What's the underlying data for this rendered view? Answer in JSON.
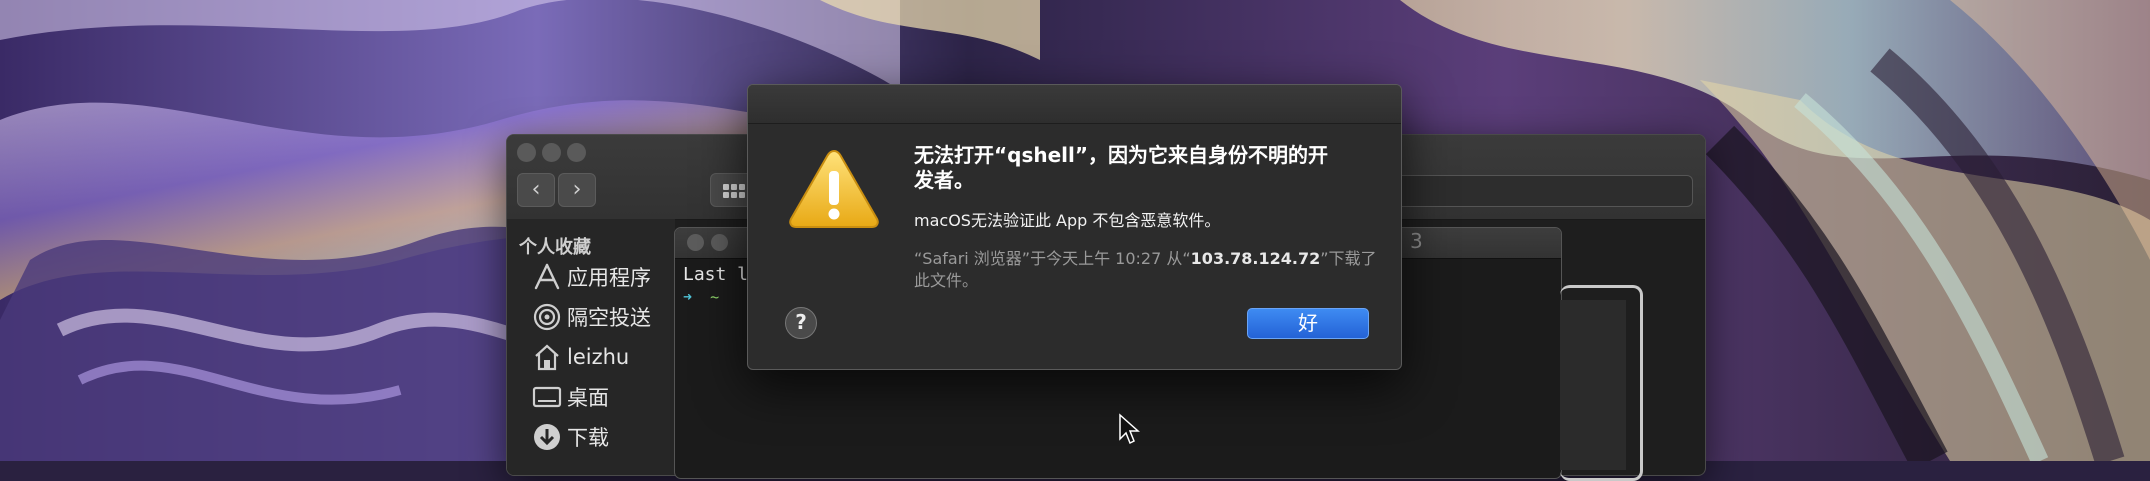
{
  "alert": {
    "title": "无法打开“qshell”，因为它来自身份不明的开发者。",
    "message": "macOS无法验证此 App 不包含恶意软件。",
    "info_prefix": "“Safari 浏览器”于今天上午 10:27 从“",
    "info_host": "103.78.124.72",
    "info_suffix": "”下载了此文件。",
    "help_label": "?",
    "ok_label": "好",
    "icon": "warning-icon"
  },
  "finder": {
    "back_icon": "‹",
    "forward_icon": "›",
    "sidebar_header": "个人收藏",
    "sidebar_items": [
      {
        "label": "应用程序",
        "icon": "applications-icon"
      },
      {
        "label": "隔空投送",
        "icon": "airdrop-icon"
      },
      {
        "label": "leizhu",
        "icon": "home-icon"
      },
      {
        "label": "桌面",
        "icon": "desktop-icon"
      },
      {
        "label": "下载",
        "icon": "downloads-icon"
      }
    ]
  },
  "terminal": {
    "first_line": "Last l",
    "prompt_arrow": "➜",
    "prompt_dir": "~",
    "title_suffix": "3"
  },
  "colors": {
    "accent_blue": "#2e74e8",
    "warning_yellow": "#f5c332",
    "dialog_bg": "#2c2c2c"
  }
}
